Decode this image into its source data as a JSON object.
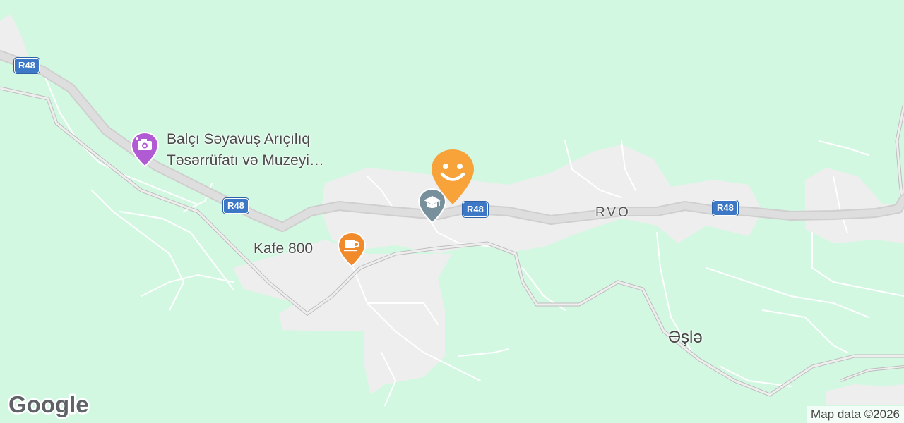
{
  "map": {
    "route_shield": "R48",
    "road_name": "RVO",
    "town": "Əşlə",
    "attribution": "Map data ©2026",
    "logo": "Google",
    "colors": {
      "land": "#d3f8e2",
      "settlement": "#eeeeee",
      "highway": "#dcdcdc",
      "road_casing": "#c8c8c8",
      "shield": "#3c78c6",
      "pin_purple": "#b05bd3",
      "pin_orange": "#f08a2b",
      "pin_gray": "#78909c"
    }
  },
  "pois": [
    {
      "name_line1": "Balçı Səyavuş Arıçılıq",
      "name_line2": "Təsərrüfatı və Muzeyi…",
      "icon": "camera-icon"
    },
    {
      "name": "Kafe 800",
      "icon": "coffee-cup-icon"
    },
    {
      "name": "",
      "icon": "school-graduation-cap-icon"
    },
    {
      "name": "",
      "icon": "smiley-face-icon"
    }
  ]
}
